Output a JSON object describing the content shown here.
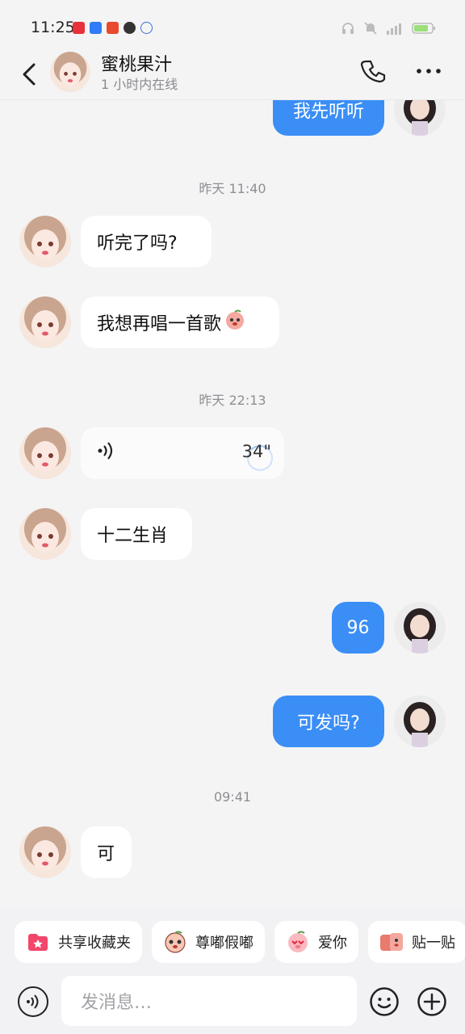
{
  "status_bar": {
    "time": "11:25",
    "battery_level_percent": 80
  },
  "header": {
    "contact_name": "蜜桃果汁",
    "contact_status": "1 小时内在线"
  },
  "messages": {
    "m0_text": "我先听听",
    "ts1": "昨天 11:40",
    "m1_text": "听完了吗?",
    "m2_text": "我想再唱一首歌",
    "ts2": "昨天 22:13",
    "m3_duration": "34\"",
    "m4_text": "十二生肖",
    "m5_text": "96",
    "m6_text": "可发吗?",
    "ts3": "09:41",
    "m7_text": "可"
  },
  "quick_actions": {
    "shared_favorites": "共享收藏夹",
    "pout": "尊嘟假嘟",
    "love_you": "爱你",
    "sticker": "贴一贴"
  },
  "input": {
    "placeholder": "发消息…"
  },
  "colors": {
    "accent": "#3a8ef6",
    "background": "#f4f4f5",
    "incoming_bubble": "#ffffff"
  },
  "icons": [
    "back-icon",
    "phone-icon",
    "more-icon",
    "voice-wave-icon",
    "folder-star-icon",
    "peach-face-icon",
    "pig-heart-icon",
    "kiss-sticker-icon",
    "voice-input-icon",
    "emoji-icon",
    "plus-icon"
  ]
}
